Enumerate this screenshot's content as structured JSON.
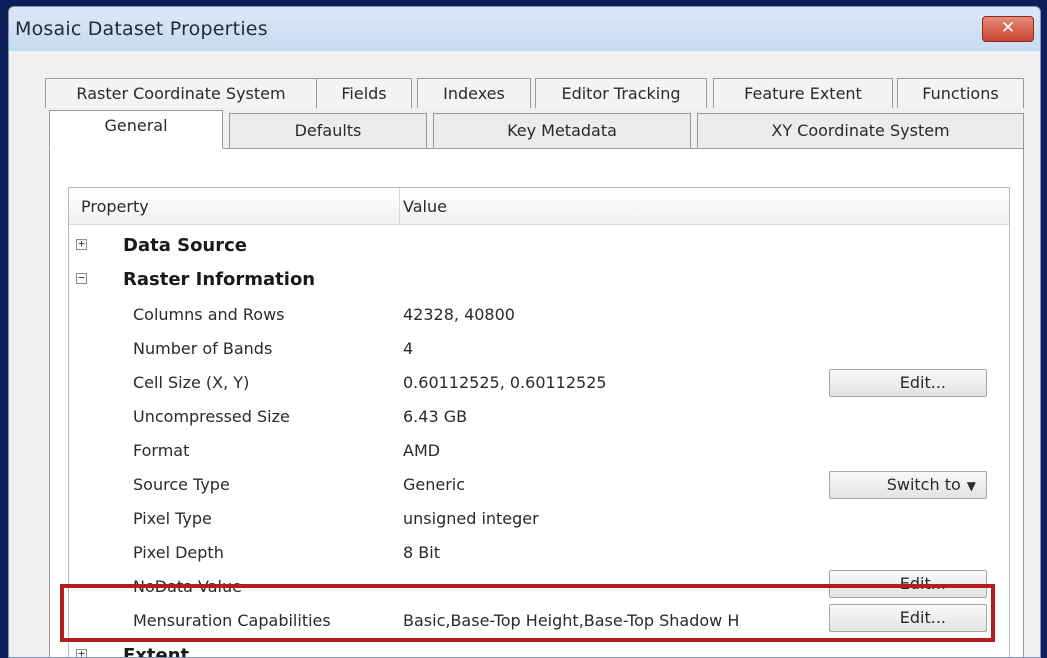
{
  "window": {
    "title": "Mosaic Dataset Properties",
    "close_label": "✕"
  },
  "tabs_row1": [
    "Raster Coordinate System",
    "Fields",
    "Indexes",
    "Editor Tracking",
    "Feature Extent",
    "Functions"
  ],
  "tabs_row2": [
    "General",
    "Defaults",
    "Key Metadata",
    "XY Coordinate System"
  ],
  "active_tab": "General",
  "grid": {
    "col_property": "Property",
    "col_value": "Value",
    "groups": {
      "data_source": {
        "label": "Data Source",
        "expander": "+"
      },
      "raster_information": {
        "label": "Raster Information",
        "expander": "−"
      },
      "extent": {
        "label": "Extent",
        "expander": "+"
      }
    },
    "rows": [
      {
        "label": "Columns and Rows",
        "value": "42328, 40800"
      },
      {
        "label": "Number of Bands",
        "value": "4"
      },
      {
        "label": "Cell Size (X, Y)",
        "value": "0.60112525, 0.60112525",
        "button": "Edit..."
      },
      {
        "label": "Uncompressed Size",
        "value": "6.43 GB"
      },
      {
        "label": "Format",
        "value": "AMD"
      },
      {
        "label": "Source Type",
        "value": "Generic",
        "button": "Switch to"
      },
      {
        "label": "Pixel Type",
        "value": "unsigned integer"
      },
      {
        "label": "Pixel Depth",
        "value": "8 Bit"
      },
      {
        "label": "NoData Value",
        "value": "",
        "button": "Edit..."
      },
      {
        "label": "Mensuration Capabilities",
        "value": "Basic,Base-Top Height,Base-Top Shadow H",
        "button": "Edit..."
      }
    ]
  },
  "highlight_color": "#b51c1c",
  "icons": {
    "expand": "plus-box-icon",
    "collapse": "minus-box-icon",
    "dropdown": "chevron-down-icon"
  }
}
